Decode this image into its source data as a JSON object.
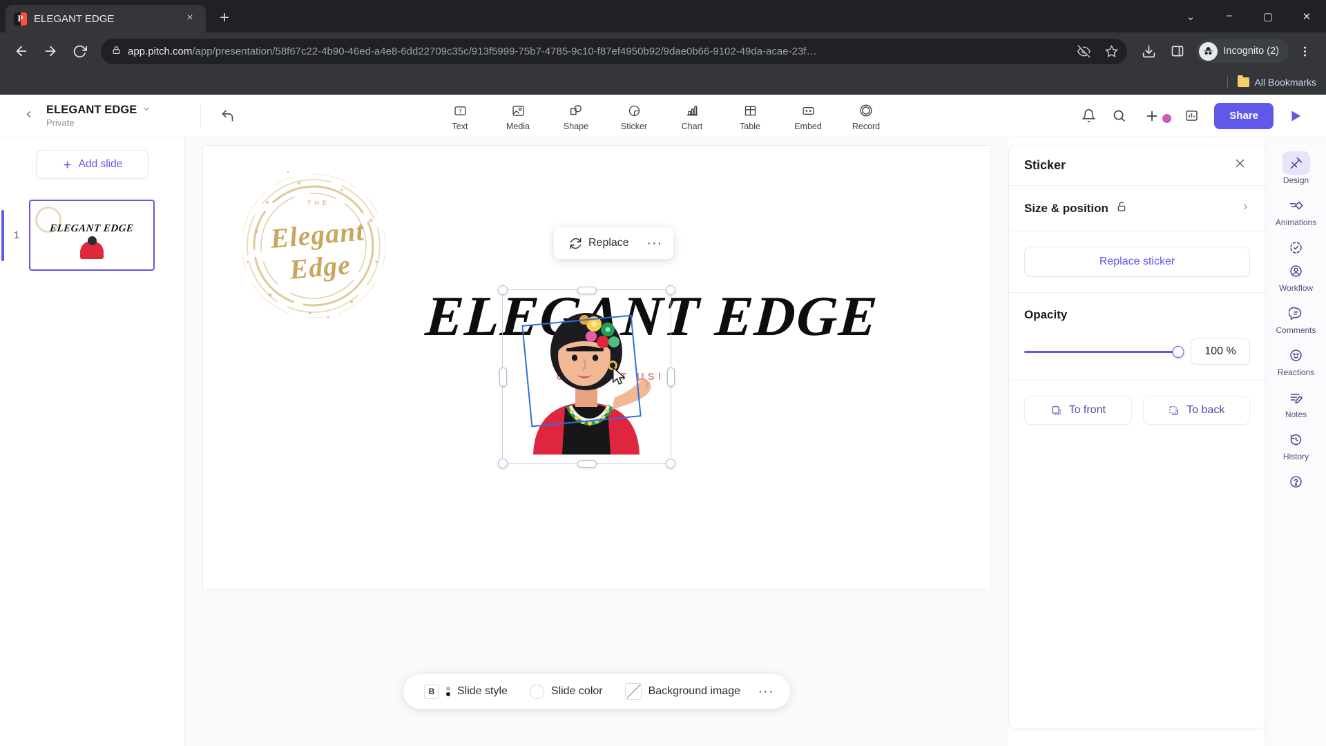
{
  "browser": {
    "tab": {
      "title": "ELEGANT EDGE",
      "favicon_letter": "P",
      "close_label": "×"
    },
    "new_tab_label": "+",
    "window_controls": {
      "minimize": "−",
      "maximize": "▢",
      "close": "✕",
      "expand": "⌄"
    },
    "nav": {
      "back": "←",
      "forward": "→",
      "reload": "⟳"
    },
    "omnibox": {
      "lock_icon": "lock-icon",
      "url_host": "app.pitch.com",
      "url_path": "/app/presentation/58f67c22-4b90-46ed-a4e8-6dd22709c35c/913f5999-75b7-4785-9c10-f87ef4950b92/9dae0b66-9102-49da-acae-23f…",
      "third_party_cookie_icon": "eye-slash-icon",
      "bookmark_icon": "star-icon"
    },
    "toolbar_icons": [
      "download-icon",
      "side-panel-icon"
    ],
    "profile": {
      "label": "Incognito (2)",
      "avatar_icon": "incognito-hat-icon"
    },
    "menu_icon": "three-dot-menu-icon",
    "bookmarks_bar": {
      "all_bookmarks_label": "All Bookmarks",
      "folder_icon": "folder-icon"
    }
  },
  "app": {
    "header": {
      "back_icon": "chevron-left-icon",
      "deck_title": "ELEGANT EDGE",
      "deck_visibility": "Private",
      "title_caret_icon": "chevron-down-icon",
      "undo_icon": "undo-arrow-icon",
      "tools": [
        {
          "label": "Text",
          "icon": "text-box-icon"
        },
        {
          "label": "Media",
          "icon": "image-icon"
        },
        {
          "label": "Shape",
          "icon": "shapes-icon"
        },
        {
          "label": "Sticker",
          "icon": "sticker-icon"
        },
        {
          "label": "Chart",
          "icon": "bar-chart-icon"
        },
        {
          "label": "Table",
          "icon": "table-grid-icon"
        },
        {
          "label": "Embed",
          "icon": "code-brackets-icon"
        },
        {
          "label": "Record",
          "icon": "record-circle-icon"
        }
      ],
      "right_icons": [
        {
          "name": "notifications-bell-icon"
        },
        {
          "name": "search-icon"
        },
        {
          "name": "add-plus-icon"
        },
        {
          "name": "analytics-icon"
        }
      ],
      "share_label": "Share",
      "present_icon": "play-triangle-icon"
    },
    "slides_panel": {
      "add_slide_label": "Add slide",
      "add_slide_icon": "plus-icon",
      "slides": [
        {
          "number": "1",
          "title_text": "ELEGANT EDGE",
          "selected": true
        }
      ]
    },
    "canvas": {
      "logo_kicker": "THE",
      "logo_script": "Elegant Edge",
      "headline": "ELEGANT EDGE",
      "contact_text": "CONTACT US!",
      "floating_toolbar": {
        "replace_label": "Replace",
        "replace_icon": "refresh-arrows-icon",
        "more_label": "···"
      },
      "selection": {
        "rotation_hint": "rotated-sticker-selection",
        "cursor_icon": "mouse-pointer-icon"
      }
    },
    "style_bar": {
      "items": [
        {
          "label": "Slide style",
          "icon": "text-style-icon"
        },
        {
          "label": "Slide color",
          "icon": "color-circle-icon"
        },
        {
          "label": "Background image",
          "icon": "background-image-icon"
        }
      ],
      "more_label": "···"
    },
    "properties_panel": {
      "title": "Sticker",
      "close_icon": "close-x-icon",
      "size_position_label": "Size & position",
      "lock_icon": "unlock-icon",
      "expand_icon": "chevron-right-icon",
      "replace_sticker_label": "Replace sticker",
      "opacity_label": "Opacity",
      "opacity_value": "100 %",
      "opacity_percent": 100,
      "to_front_label": "To front",
      "to_front_icon": "bring-to-front-icon",
      "to_back_label": "To back",
      "to_back_icon": "send-to-back-icon"
    },
    "rail": {
      "items": [
        {
          "label": "Design",
          "icon": "design-wand-icon",
          "active": true
        },
        {
          "label": "Animations",
          "icon": "animation-icon",
          "active": false
        },
        {
          "label": "Workflow",
          "icon": "workflow-check-icon",
          "secondary_icon": "person-circle-icon",
          "active": false
        },
        {
          "label": "Comments",
          "icon": "comment-bubble-icon",
          "active": false
        },
        {
          "label": "Reactions",
          "icon": "smiley-icon",
          "active": false
        },
        {
          "label": "Notes",
          "icon": "notes-pencil-icon",
          "active": false
        },
        {
          "label": "History",
          "icon": "history-clock-icon",
          "active": false
        },
        {
          "label": "",
          "icon": "help-question-icon",
          "active": false
        }
      ]
    }
  },
  "colors": {
    "accent": "#6058e8",
    "chrome_dark": "#202124",
    "chrome_light": "#35363a",
    "selection_blue": "#2f6fe0",
    "gold": "#c8a85f"
  }
}
